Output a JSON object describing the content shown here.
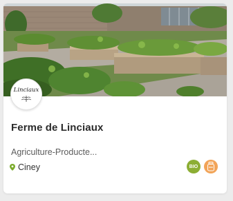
{
  "card": {
    "image_alt": "Potager en carrés surélevés",
    "logo_text": "Linciaux",
    "title": "Ferme de Linciaux",
    "category": "Agriculture-Producte...",
    "location": "Ciney",
    "badges": [
      {
        "label": "BIO",
        "icon": "bio-label-icon",
        "color": "#8cae34"
      },
      {
        "label": "",
        "icon": "jar-product-icon",
        "color": "#f2a458"
      }
    ]
  },
  "colors": {
    "accent_green": "#8cae34",
    "pin_green": "#7bab2c",
    "product_orange": "#f2a458",
    "title_text": "#2b2b2b"
  }
}
